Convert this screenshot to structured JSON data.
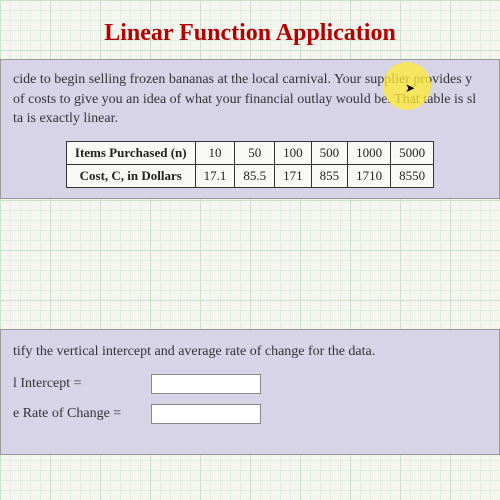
{
  "title": "Linear Function Application",
  "problem_text": "cide to begin selling frozen bananas at the local carnival. Your supplier provides y of costs to give you an idea of what your financial outlay would be. That table is sl ta is exactly linear.",
  "chart_data": {
    "type": "table",
    "headers": [
      "Items Purchased (n)",
      "Cost, C, in Dollars"
    ],
    "columns": [
      10,
      50,
      100,
      500,
      1000,
      5000
    ],
    "rows": [
      [
        17.1,
        85.5,
        171,
        855,
        1710,
        8550
      ]
    ]
  },
  "answer_section": {
    "instruction": "tify the vertical intercept and average rate of change for the data.",
    "fields": [
      {
        "label": "l Intercept =",
        "value": ""
      },
      {
        "label": "e Rate of Change =",
        "value": ""
      }
    ]
  }
}
